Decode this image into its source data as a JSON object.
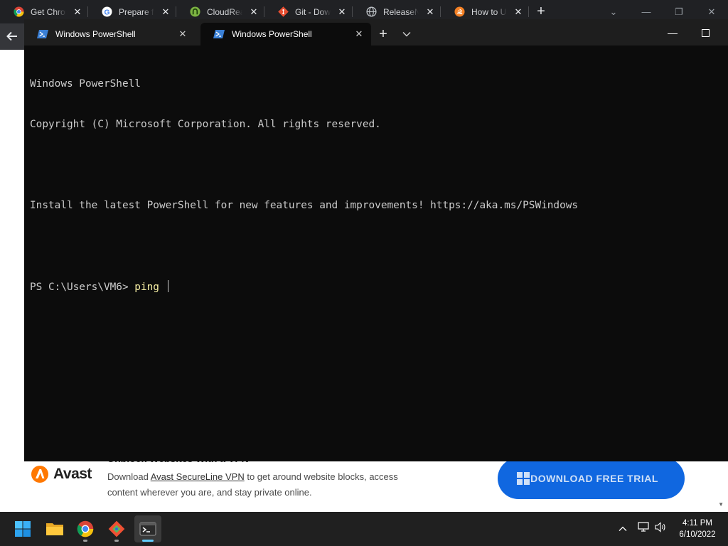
{
  "browser": {
    "tabs": [
      {
        "title": "Get Chrome",
        "icon": "chrome-icon"
      },
      {
        "title": "Prepare for",
        "icon": "google-icon"
      },
      {
        "title": "CloudReady",
        "icon": "cloudready-icon"
      },
      {
        "title": "Git - Downloads",
        "icon": "git-icon"
      },
      {
        "title": "ReleaseNotes",
        "icon": "globe-icon"
      },
      {
        "title": "How to Uninstall",
        "icon": "stackoverflow-icon"
      }
    ],
    "close_glyph": "✕",
    "new_tab_glyph": "+"
  },
  "ad": {
    "brand": "Avast",
    "headline": "Unblock Websites With a VPN",
    "text_before": "Download ",
    "link": "Avast SecureLine VPN",
    "text_after": " to get around website blocks, access content wherever you are, and stay private online.",
    "button_label": "DOWNLOAD FREE TRIAL",
    "button_color": "#1067e0",
    "brand_color": "#ff7800"
  },
  "terminal": {
    "tabs": [
      {
        "title": "Windows PowerShell",
        "active": false
      },
      {
        "title": "Windows PowerShell",
        "active": true
      }
    ],
    "new_tab_glyph": "+",
    "lines": [
      "Windows PowerShell",
      "Copyright (C) Microsoft Corporation. All rights reserved.",
      "",
      "Install the latest PowerShell for new features and improvements! https://aka.ms/PSWindows",
      ""
    ],
    "prompt": "PS C:\\Users\\VM6> ",
    "input": "ping ",
    "input_color": "#f9f1a5",
    "background": "#0c0c0c"
  },
  "taskbar": {
    "apps": [
      "start-icon",
      "file-explorer-icon",
      "chrome-icon",
      "git-gui-icon",
      "terminal-icon"
    ],
    "active_app": "terminal-icon",
    "time": "4:11 PM",
    "date": "6/10/2022"
  }
}
